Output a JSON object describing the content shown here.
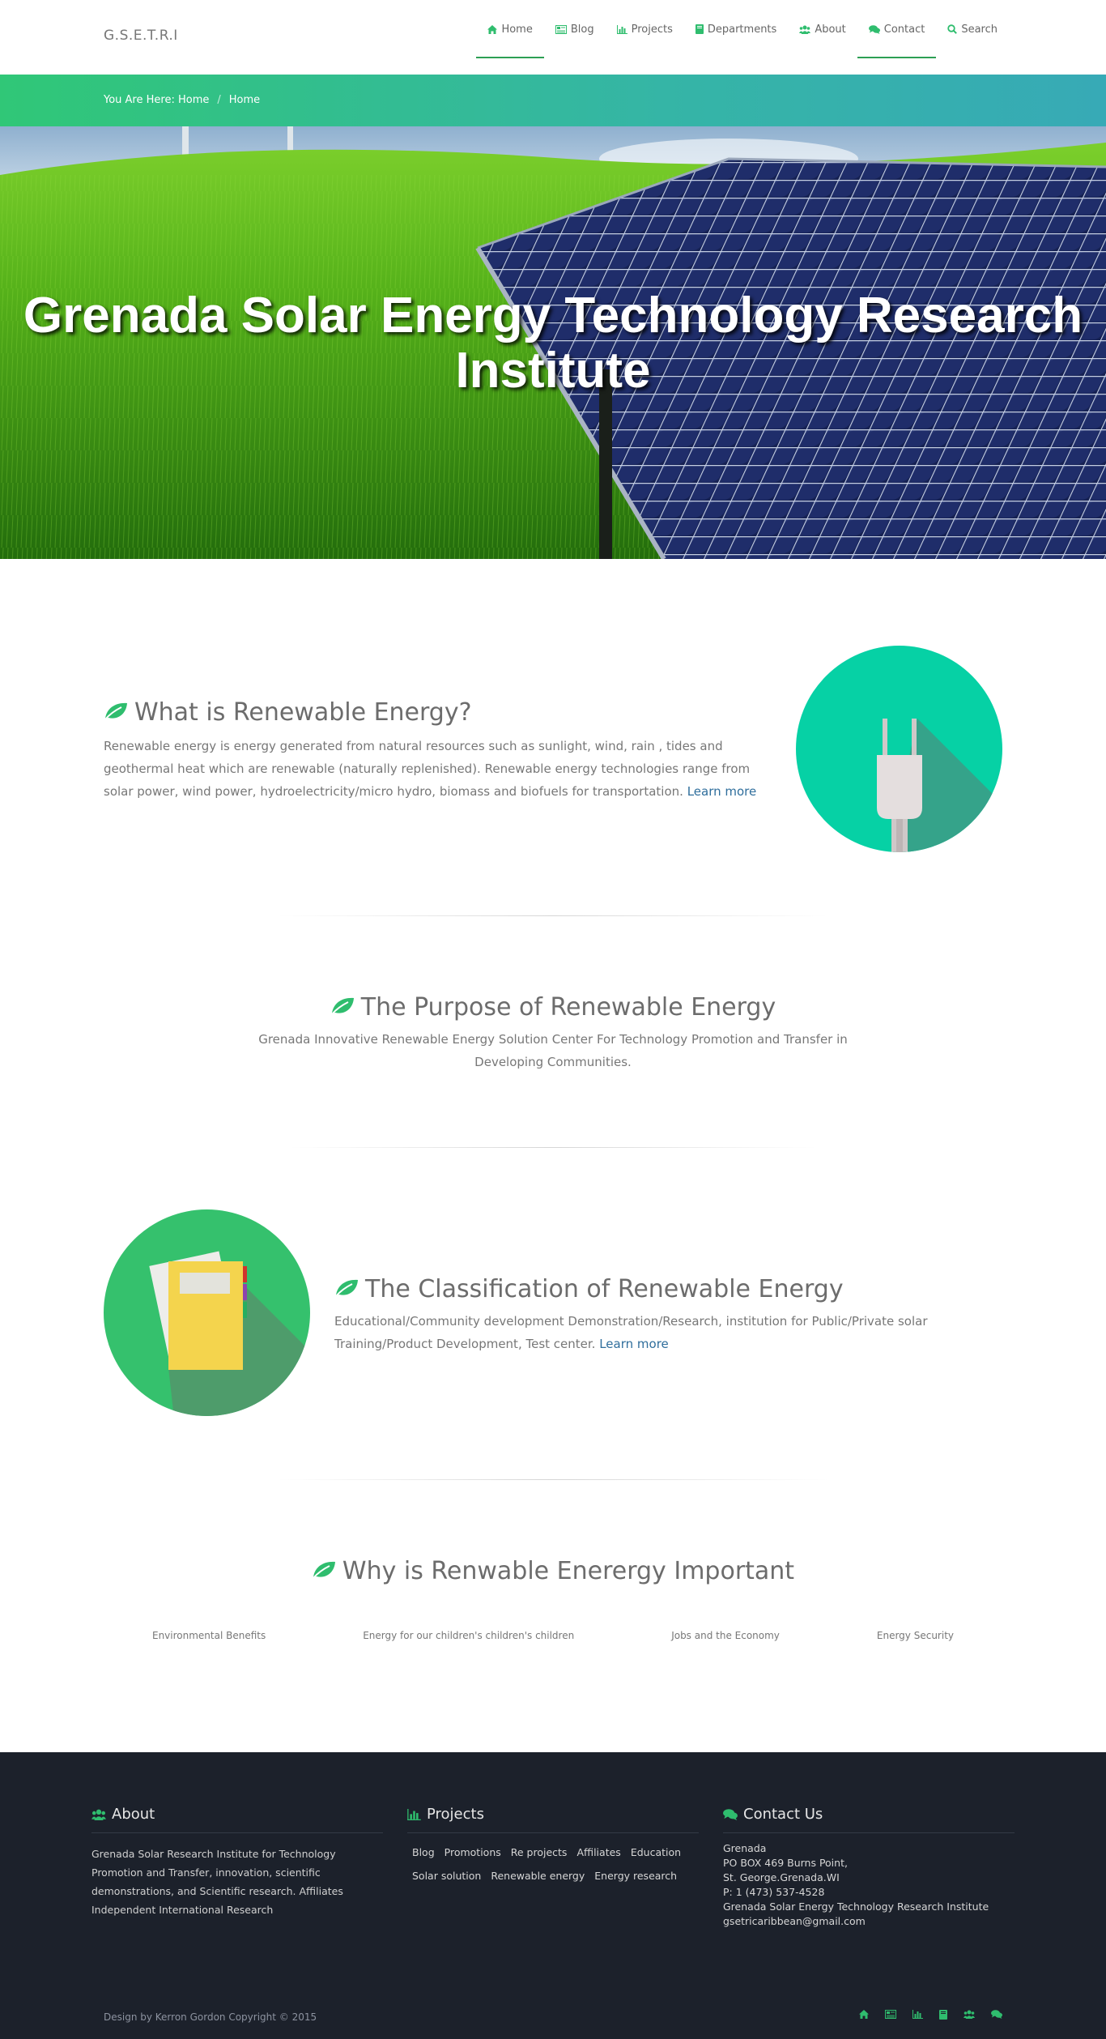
{
  "brand": "G.S.E.T.R.I",
  "nav": [
    {
      "label": "Home",
      "icon": "home-icon"
    },
    {
      "label": "Blog",
      "icon": "newspaper-icon"
    },
    {
      "label": "Projects",
      "icon": "bar-chart-icon"
    },
    {
      "label": "Departments",
      "icon": "book-icon"
    },
    {
      "label": "About",
      "icon": "users-icon"
    },
    {
      "label": "Contact",
      "icon": "comments-icon"
    },
    {
      "label": "Search",
      "icon": "search-icon"
    }
  ],
  "breadcrumb": {
    "prefix": "You Are Here: Home",
    "separator": "/",
    "current": "Home"
  },
  "hero": {
    "title": "Grenada Solar Energy Technology Research Institute"
  },
  "section1": {
    "title": "What is Renewable Energy?",
    "text": "Renewable energy is energy generated from natural resources such as sunlight, wind, rain , tides and geothermal heat which are renewable (naturally replenished). Renewable energy technologies range from solar power, wind power, hydroelectricity/micro hydro, biomass and biofuels for transportation.",
    "link": "Learn more"
  },
  "section2": {
    "title": "The Purpose of Renewable Energy",
    "text": "Grenada Innovative Renewable Energy Solution Center For Technology Promotion and Transfer in Developing Communities."
  },
  "section3": {
    "title": "The Classification of Renewable Energy",
    "text": "Educational/Community development Demonstration/Research, institution for Public/Private solar Training/Product Development, Test center.",
    "link": "Learn more"
  },
  "section4": {
    "title": "Why is Renwable Enerergy Important",
    "items": [
      "Environmental Benefits",
      "Energy for our children's children's children",
      "Jobs and the Economy",
      "Energy Security"
    ]
  },
  "footer": {
    "about": {
      "title": "About",
      "text": "Grenada Solar Research Institute for Technology Promotion and Transfer, innovation, scientific demonstrations, and Scientific research. Affiliates Independent International Research"
    },
    "projects": {
      "title": "Projects",
      "tags": [
        "Blog",
        "Promotions",
        "Re projects",
        "Affiliates",
        "Education",
        "Solar solution",
        "Renewable energy",
        "Energy research"
      ]
    },
    "contact": {
      "title": "Contact Us",
      "lines": [
        "Grenada",
        "PO BOX 469 Burns Point,",
        "St. George.Grenada.WI",
        "P: 1 (473) 537-4528",
        "Grenada Solar Energy Technology Research Institute",
        "gsetricaribbean@gmail.com"
      ]
    },
    "copyright": "Design by Kerron Gordon Copyright © 2015"
  },
  "colors": {
    "accent": "#2fbd6e",
    "footer_bg": "#1c212b",
    "link": "#2f6e9c"
  }
}
